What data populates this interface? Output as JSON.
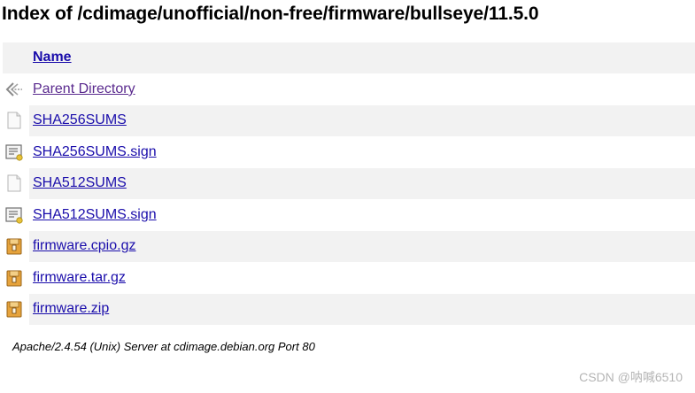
{
  "page": {
    "title": "Index of /cdimage/unofficial/non-free/firmware/bullseye/11.5.0"
  },
  "listing": {
    "header": {
      "name_label": "Name"
    },
    "rows": [
      {
        "name": "Parent Directory",
        "icon": "back-arrow-icon"
      },
      {
        "name": "SHA256SUMS",
        "icon": "text-file-icon"
      },
      {
        "name": "SHA256SUMS.sign",
        "icon": "signature-file-icon"
      },
      {
        "name": "SHA512SUMS",
        "icon": "text-file-icon"
      },
      {
        "name": "SHA512SUMS.sign",
        "icon": "signature-file-icon"
      },
      {
        "name": "firmware.cpio.gz",
        "icon": "archive-file-icon"
      },
      {
        "name": "firmware.tar.gz",
        "icon": "archive-file-icon"
      },
      {
        "name": "firmware.zip",
        "icon": "archive-file-icon"
      }
    ]
  },
  "footer": {
    "server_line": "Apache/2.4.54 (Unix) Server at cdimage.debian.org Port 80"
  },
  "watermark": {
    "text": "CSDN @呐喊6510"
  },
  "colors": {
    "link": "#1a0dab",
    "visited_link": "#5a2a8e",
    "row_shade": "#f2f2f2"
  }
}
